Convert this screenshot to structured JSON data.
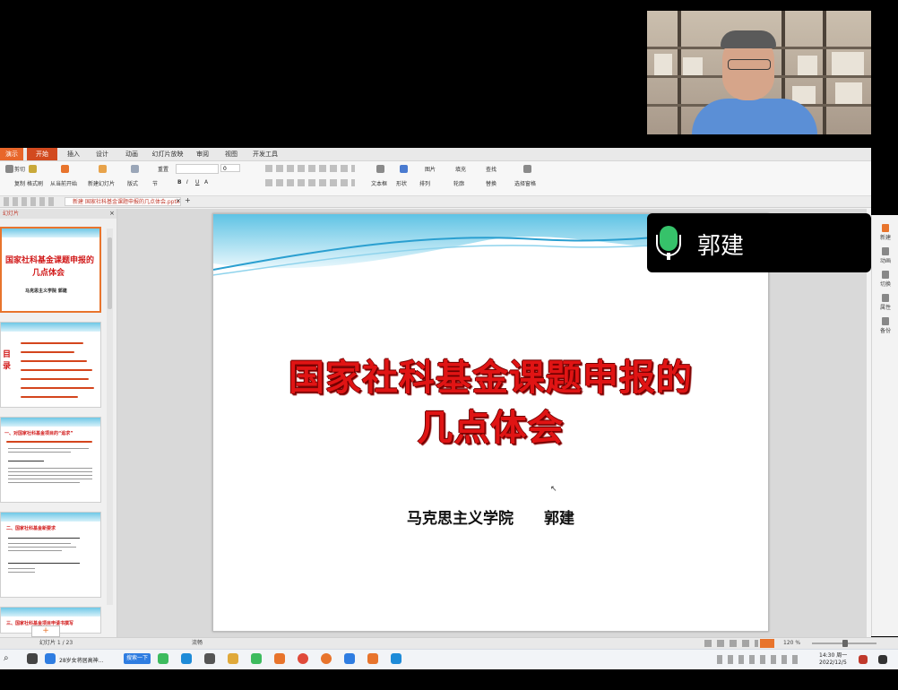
{
  "app": {
    "menu_button": "演示",
    "tabs": [
      "开始",
      "插入",
      "设计",
      "动画",
      "幻灯片放映",
      "审阅",
      "视图",
      "开发工具"
    ],
    "active_tab": "开始"
  },
  "toolbar": {
    "cut": "剪切",
    "copy": "复制",
    "format_painter": "格式刷",
    "from_current": "从当前开始",
    "new_slide": "新建幻灯片",
    "layout": "版式",
    "section": "节",
    "reset": "重置",
    "font_size": "0",
    "textbox": "文本框",
    "shape": "形状",
    "arrange": "排列",
    "outline": "轮廓",
    "picture": "图片",
    "fill": "填充",
    "find": "查找",
    "replace": "替换",
    "select_pane": "选择窗格"
  },
  "document": {
    "tab_title": "国家社科基金课题申报的几点体会.pptx",
    "tab_prefix": "新建"
  },
  "thumbnails": {
    "panel_header": "幻灯片",
    "slide1_title_line1": "国家社科基金课题申报的",
    "slide1_title_line2": "几点体会",
    "slide1_sub": "马克思主义学院  郭建",
    "slide2_side": "目录",
    "slide3_heading": "一、对国家社科基金项目的“追求”",
    "slide4_heading": "二、国家社科基金新要求",
    "slide5_heading": "三、国家社科基金项目申请书撰写"
  },
  "slide": {
    "title_line1": "国家社科基金课题申报的",
    "title_line2": "几点体会",
    "author": "马克思主义学院　　郭建"
  },
  "right_panel": {
    "items": [
      "新建",
      "动画",
      "切换",
      "属性",
      "备份"
    ]
  },
  "status": {
    "slide_counter": "幻灯片 1 / 23",
    "theme": "流畅",
    "zoom": "120 %"
  },
  "taskbar": {
    "browser_item": "28岁女将居高神...",
    "search_item": "搜索一下",
    "time": "14:30 周一",
    "date": "2022/12/5"
  },
  "meeting": {
    "speaker_name": "郭建"
  }
}
